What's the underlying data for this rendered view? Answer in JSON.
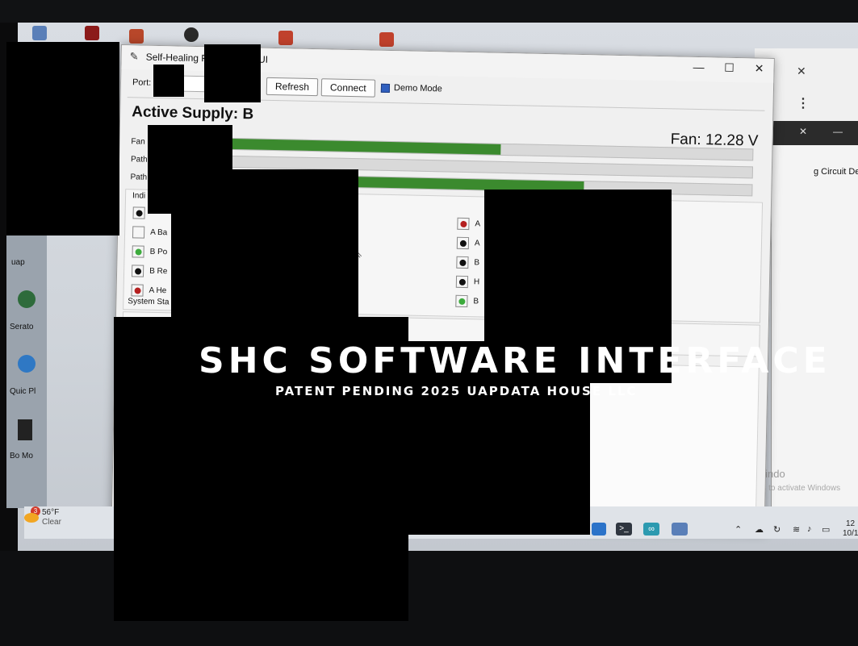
{
  "window": {
    "title": "Self-Healing Po     panded GUI",
    "minimize": "—",
    "maximize": "☐",
    "close": "✕"
  },
  "toolbar": {
    "port_label": "Port:",
    "refresh_label": "Refresh",
    "connect_label": "Connect",
    "demo_mode_label": "Demo Mode",
    "demo_mode_checked": true
  },
  "status": {
    "active_supply": "Active Supply: B",
    "fan_voltage": "Fan: 12.28 V"
  },
  "bars": [
    {
      "label": "Fan",
      "fill": 0.58
    },
    {
      "label": "Path",
      "fill": 0.0
    },
    {
      "label": "Path",
      "fill": 0.72
    }
  ],
  "indicators": {
    "section_label": "Indi",
    "left": [
      {
        "label": "",
        "state": "black"
      },
      {
        "label": "A Ba",
        "state": "off"
      },
      {
        "label": "B Po",
        "state": "green"
      },
      {
        "label": "B Re",
        "state": "black"
      },
      {
        "label": "A He",
        "state": "red"
      }
    ],
    "right": [
      {
        "label": "A",
        "state": "red"
      },
      {
        "label": "A",
        "state": "black"
      },
      {
        "label": "B",
        "state": "black"
      },
      {
        "label": "H",
        "state": "black"
      },
      {
        "label": "B",
        "state": "green"
      }
    ]
  },
  "system_status_label": "System Sta",
  "right_window": {
    "title_text": "g Circuit De",
    "close": "✕",
    "minimize": "—"
  },
  "taskbar": {
    "weather_badge": "3",
    "temperature": "56°F",
    "condition": "Clear",
    "clock_time": "12",
    "clock_date": "10/1"
  },
  "watermark": {
    "line1": "Activate Windo",
    "line2": "Go to Settings to activate Windows"
  },
  "overlay": {
    "title": "SHC SOFTWARE INTERFACE",
    "subtitle": "PATENT PENDING 2025 UAPDATA HOUSE LLC"
  },
  "desktop_labels": {
    "left1": "uap",
    "left2": "Serato",
    "left3": "Quic Pl",
    "left4": "Bo Mo"
  },
  "colors": {
    "bar_green": "#3b8a2e",
    "led_red": "#b52020",
    "led_green": "#3cab3c",
    "led_black": "#111111",
    "demo_check": "#2f5fbf"
  }
}
